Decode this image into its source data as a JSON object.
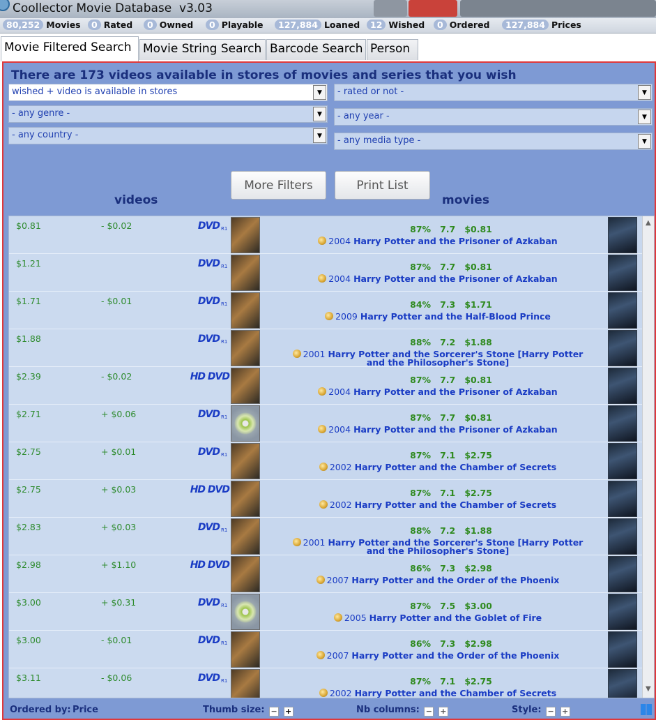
{
  "app": {
    "title": "Coollector Movie Database  v3.03"
  },
  "stats": [
    {
      "num": "80,252",
      "label": "Movies"
    },
    {
      "num": "0",
      "label": "Rated"
    },
    {
      "num": "0",
      "label": "Owned"
    },
    {
      "num": "0",
      "label": "Playable"
    },
    {
      "num": "127,884",
      "label": "Loaned"
    },
    {
      "num": "12",
      "label": "Wished"
    },
    {
      "num": "0",
      "label": "Ordered"
    },
    {
      "num": "127,884",
      "label": "Prices"
    }
  ],
  "tabs": [
    {
      "label": "Movie Filtered Search",
      "active": true
    },
    {
      "label": "Movie String Search",
      "active": false
    },
    {
      "label": "Barcode Search",
      "active": false
    },
    {
      "label": "Person",
      "active": false
    }
  ],
  "panel": {
    "headline": "There are 173 videos available in stores of movies and series that you wish",
    "filters": {
      "wished": "wished + video is available in stores",
      "rated": "- rated or not -",
      "genre": "- any genre -",
      "year": "- any year -",
      "country": "- any country -",
      "media_type": "- any media type -"
    },
    "buttons": {
      "more_filters": "More Filters",
      "print_list": "Print List"
    },
    "columns": {
      "videos": "videos",
      "movies": "movies"
    }
  },
  "rows": [
    {
      "price": "$0.81",
      "diff": "- $0.02",
      "media": "DVD",
      "region": "R1",
      "cover": "cover",
      "score": "87%",
      "rating": "7.7",
      "best": "$0.81",
      "year": "2004",
      "title": "Harry Potter and the Prisoner of Azkaban"
    },
    {
      "price": "$1.21",
      "diff": "",
      "media": "DVD",
      "region": "R1",
      "cover": "cover",
      "score": "87%",
      "rating": "7.7",
      "best": "$0.81",
      "year": "2004",
      "title": "Harry Potter and the Prisoner of Azkaban"
    },
    {
      "price": "$1.71",
      "diff": "- $0.01",
      "media": "DVD",
      "region": "R1",
      "cover": "cover",
      "score": "84%",
      "rating": "7.3",
      "best": "$1.71",
      "year": "2009",
      "title": "Harry Potter and the Half-Blood Prince"
    },
    {
      "price": "$1.88",
      "diff": "",
      "media": "DVD",
      "region": "R1",
      "cover": "cover",
      "score": "88%",
      "rating": "7.2",
      "best": "$1.88",
      "year": "2001",
      "title": "Harry Potter and the Sorcerer's Stone [Harry Potter and the Philosopher's Stone]"
    },
    {
      "price": "$2.39",
      "diff": "- $0.02",
      "media": "HD DVD",
      "region": "",
      "cover": "cover",
      "score": "87%",
      "rating": "7.7",
      "best": "$0.81",
      "year": "2004",
      "title": "Harry Potter and the Prisoner of Azkaban"
    },
    {
      "price": "$2.71",
      "diff": "+ $0.06",
      "media": "DVD",
      "region": "R1",
      "cover": "disc",
      "score": "87%",
      "rating": "7.7",
      "best": "$0.81",
      "year": "2004",
      "title": "Harry Potter and the Prisoner of Azkaban"
    },
    {
      "price": "$2.75",
      "diff": "+ $0.01",
      "media": "DVD",
      "region": "R1",
      "cover": "cover",
      "score": "87%",
      "rating": "7.1",
      "best": "$2.75",
      "year": "2002",
      "title": "Harry Potter and the Chamber of Secrets"
    },
    {
      "price": "$2.75",
      "diff": "+ $0.03",
      "media": "HD DVD",
      "region": "",
      "cover": "cover",
      "score": "87%",
      "rating": "7.1",
      "best": "$2.75",
      "year": "2002",
      "title": "Harry Potter and the Chamber of Secrets"
    },
    {
      "price": "$2.83",
      "diff": "+ $0.03",
      "media": "DVD",
      "region": "R1",
      "cover": "cover",
      "score": "88%",
      "rating": "7.2",
      "best": "$1.88",
      "year": "2001",
      "title": "Harry Potter and the Sorcerer's Stone [Harry Potter and the Philosopher's Stone]"
    },
    {
      "price": "$2.98",
      "diff": "+ $1.10",
      "media": "HD DVD",
      "region": "",
      "cover": "cover",
      "score": "86%",
      "rating": "7.3",
      "best": "$2.98",
      "year": "2007",
      "title": "Harry Potter and the Order of the Phoenix"
    },
    {
      "price": "$3.00",
      "diff": "+ $0.31",
      "media": "DVD",
      "region": "R1",
      "cover": "disc",
      "score": "87%",
      "rating": "7.5",
      "best": "$3.00",
      "year": "2005",
      "title": "Harry Potter and the Goblet of Fire"
    },
    {
      "price": "$3.00",
      "diff": "- $0.01",
      "media": "DVD",
      "region": "R1",
      "cover": "cover",
      "score": "86%",
      "rating": "7.3",
      "best": "$2.98",
      "year": "2007",
      "title": "Harry Potter and the Order of the Phoenix"
    },
    {
      "price": "$3.11",
      "diff": "- $0.06",
      "media": "DVD",
      "region": "R1",
      "cover": "cover",
      "score": "87%",
      "rating": "7.1",
      "best": "$2.75",
      "year": "2002",
      "title": "Harry Potter and the Chamber of Secrets"
    }
  ],
  "statusbar": {
    "ordered_by_label": "Ordered by:",
    "ordered_by_value": "Price",
    "thumb_size": "Thumb size:",
    "nb_columns": "Nb columns:",
    "style": "Style:",
    "minus": "−",
    "plus": "+"
  }
}
